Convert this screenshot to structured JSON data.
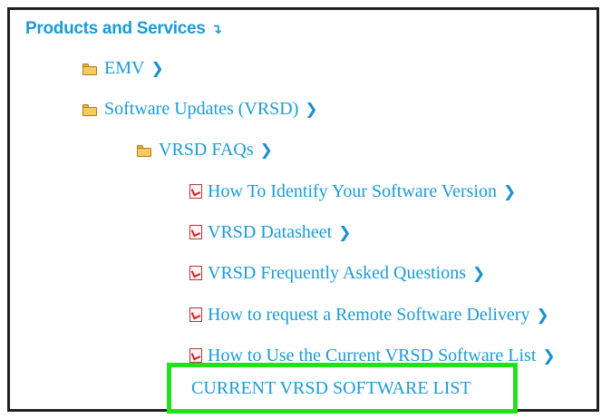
{
  "colors": {
    "link": "#1a9bd7",
    "folder": "#f4cb5c",
    "pdf": "#cc2222",
    "highlight": "#22e01c",
    "frame": "#202020"
  },
  "tree": {
    "header": {
      "label": "Products and Services",
      "icon": "down-arrow-icon"
    },
    "emv": {
      "label": "EMV",
      "icon": "folder-icon"
    },
    "software_updates": {
      "label": "Software Updates (VRSD)",
      "icon": "folder-icon"
    },
    "vrsd_faqs": {
      "label": "VRSD FAQs",
      "icon": "folder-icon"
    },
    "documents": [
      {
        "label": "How To Identify Your Software Version",
        "icon": "pdf-icon"
      },
      {
        "label": "VRSD Datasheet",
        "icon": "pdf-icon"
      },
      {
        "label": "VRSD Frequently Asked Questions",
        "icon": "pdf-icon"
      },
      {
        "label": "How to request a Remote Software Delivery",
        "icon": "pdf-icon"
      },
      {
        "label": "How to Use the Current VRSD Software List",
        "icon": "pdf-icon"
      }
    ],
    "highlighted_link": {
      "label": "CURRENT VRSD SOFTWARE LIST"
    }
  }
}
